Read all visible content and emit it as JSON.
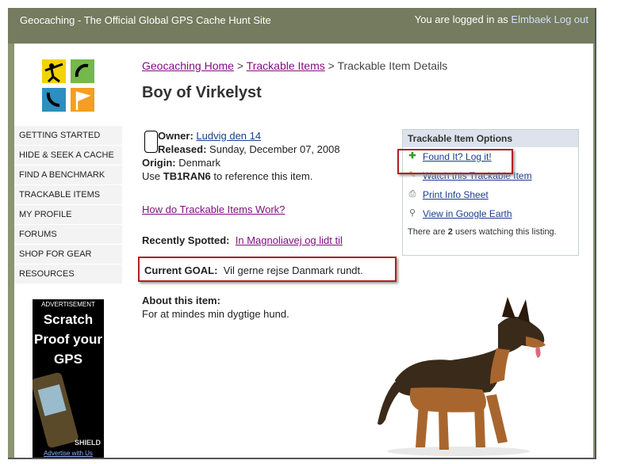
{
  "topbar": {
    "site_title": "Geocaching - The Official Global GPS Cache Hunt Site",
    "logged_in_prefix": "You are logged in as",
    "username": "Elmbaek",
    "logout": "Log out"
  },
  "nav": {
    "items": [
      {
        "label": "Getting Started"
      },
      {
        "label": "Hide & Seek a Cache"
      },
      {
        "label": "Find a Benchmark"
      },
      {
        "label": "Trackable Items"
      },
      {
        "label": "My Profile"
      },
      {
        "label": "Forums"
      },
      {
        "label": "Shop for Gear"
      },
      {
        "label": "Resources"
      }
    ]
  },
  "ad": {
    "label": "ADVERTISEMENT",
    "headline_1": "Scratch",
    "headline_2": "Proof your",
    "headline_3": "GPS",
    "brand": "SHIELD",
    "footer": "Advertise with Us"
  },
  "breadcrumb": {
    "home": "Geocaching Home",
    "sep": ">",
    "trackables": "Trackable Items",
    "current": "Trackable Item Details"
  },
  "title": "Boy of Virkelyst",
  "details": {
    "owner_label": "Owner:",
    "owner": "Ludvig den 14",
    "released_label": "Released:",
    "released": "Sunday, December 07, 2008",
    "origin_label": "Origin:",
    "origin": "Denmark",
    "use_prefix": "Use",
    "code": "TB1RAN6",
    "use_suffix": "to reference this item."
  },
  "how_link": "How do Trackable Items Work?",
  "recently": {
    "label": "Recently Spotted:",
    "value": "In Magnoliavej og lidt til"
  },
  "goal": {
    "label": "Current GOAL:",
    "value": "Vil gerne rejse Danmark rundt."
  },
  "about": {
    "label": "About this item:",
    "text": "For at mindes min dygtige hund."
  },
  "options": {
    "heading": "Trackable Item Options",
    "items": [
      {
        "label": "Found It? Log it!",
        "icon": "plus-icon"
      },
      {
        "label": "Watch this Trackable Item",
        "icon": "pencil-icon"
      },
      {
        "label": "Print Info Sheet",
        "icon": "printer-icon"
      },
      {
        "label": "View in Google Earth",
        "icon": "magnifier-icon"
      }
    ],
    "watching_prefix": "There are",
    "watching_count": "2",
    "watching_suffix": "users watching this listing."
  }
}
